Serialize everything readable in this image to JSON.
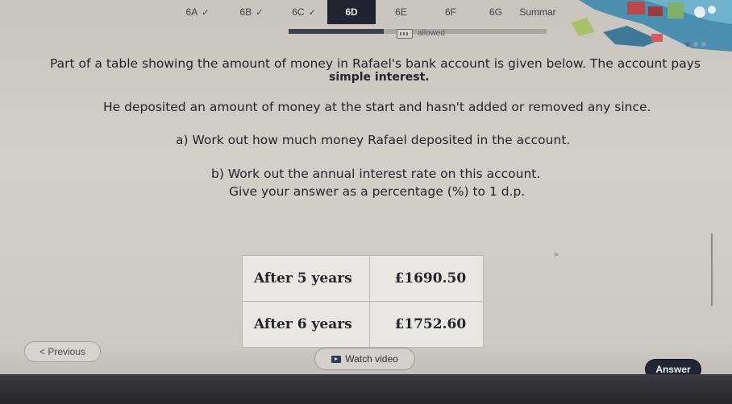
{
  "tabs": [
    {
      "label": "6A",
      "checked": true
    },
    {
      "label": "6B",
      "checked": true
    },
    {
      "label": "6C",
      "checked": true
    },
    {
      "label": "6D",
      "checked": false,
      "active": true
    },
    {
      "label": "6E",
      "checked": false
    },
    {
      "label": "6F",
      "checked": false
    },
    {
      "label": "6G",
      "checked": false
    },
    {
      "label": "Summar",
      "checked": false
    }
  ],
  "progress": {
    "fraction": 0.37
  },
  "calculator": {
    "label": "allowed",
    "icon": "calculator-icon"
  },
  "question": {
    "intro_line1": "Part of a table showing the amount of money in Rafael's bank account is given below. The account pays",
    "intro_line2": "simple interest.",
    "line3": "He deposited an amount of money at the start and hasn't added or removed any since.",
    "part_a": "a) Work out how much money Rafael deposited in the account.",
    "part_b": "b) Work out the annual interest rate on this account.",
    "part_b_hint": "Give your answer as a percentage (%) to 1 d.p."
  },
  "table": {
    "rows": [
      {
        "label": "After 5 years",
        "amount": "£1690.50"
      },
      {
        "label": "After 6 years",
        "amount": "£1752.60"
      }
    ]
  },
  "buttons": {
    "previous": "< Previous",
    "watch_video": "Watch video",
    "answer": "Answer"
  },
  "colors": {
    "accent_dark": "#1f2430",
    "background": "#d3cec8"
  }
}
